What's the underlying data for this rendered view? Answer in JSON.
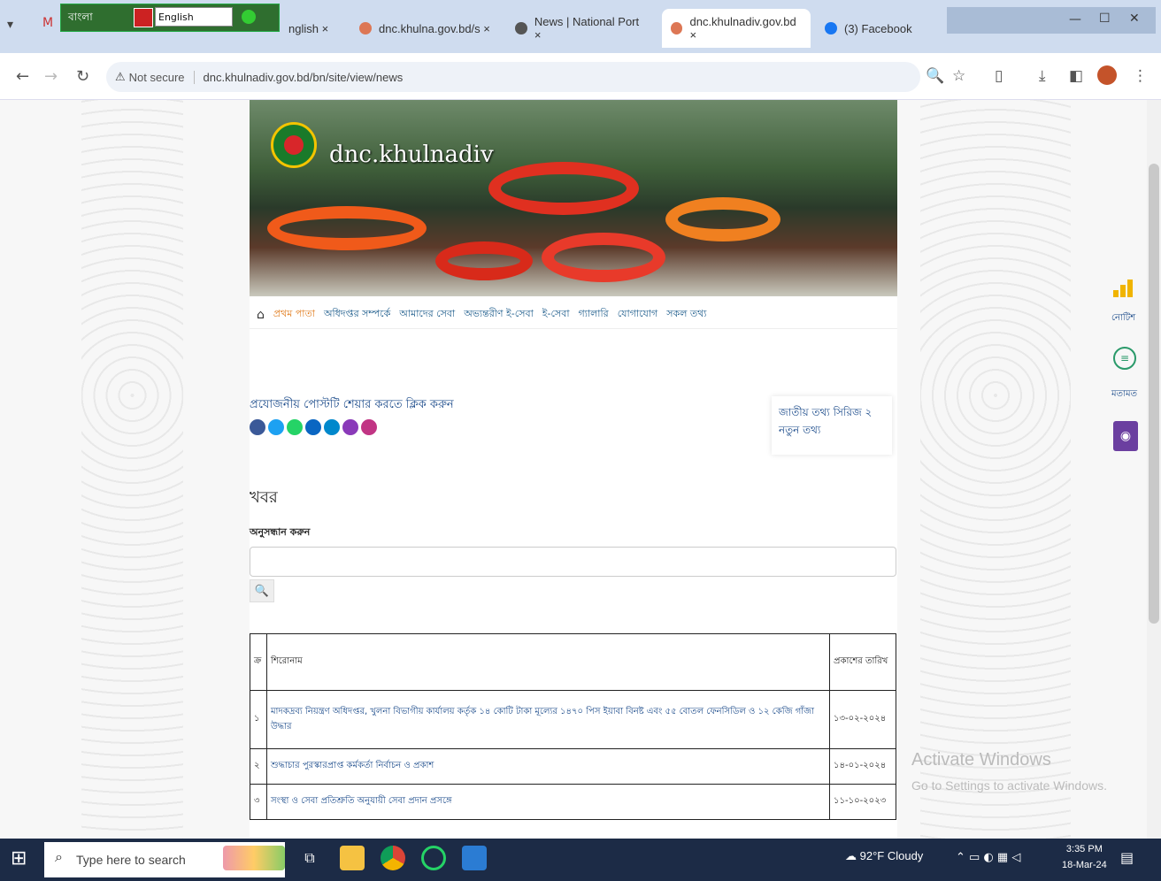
{
  "browser": {
    "tabs": [
      {
        "label": "nglish ×",
        "active": false
      },
      {
        "label": "dnc.khulna.gov.bd/s ×",
        "active": false
      },
      {
        "label": "News | National Port ×",
        "active": false
      },
      {
        "label": "dnc.khulnadiv.gov.bd ×",
        "active": true
      },
      {
        "label": "(3) Facebook",
        "active": false
      }
    ],
    "extension": {
      "lang_left": "বাংলা",
      "lang_right": "English"
    },
    "not_secure": "Not secure",
    "url": "dnc.khulnadiv.gov.bd/bn/site/view/news"
  },
  "site": {
    "name": "dnc.khulnadiv",
    "menu": [
      "প্রথম পাতা",
      "অধিদপ্তর সম্পর্কে",
      "আমাদের সেবা",
      "অভ্যন্তরীণ ই-সেবা",
      "ই-সেবা",
      "গ্যালারি",
      "যোগাযোগ",
      "সকল তথ্য"
    ],
    "social_title": "প্রযোজনীয় পোস্টটি শেয়ার করতে ক্লিক করুন",
    "social_icons": [
      "facebook-icon",
      "twitter-icon",
      "whatsapp-icon",
      "linkedin-icon",
      "messenger-icon",
      "telegram-icon",
      "share-icon"
    ],
    "notice": "জাতীয় তথ্য সিরিজ ২ নতুন তথ্য",
    "page_title": "খবর",
    "search_label": "অনুসন্ধান করুন",
    "search_placeholder": ""
  },
  "news_table": {
    "headers": [
      "ক্র",
      "শিরোনাম",
      "প্রকাশের তারিখ"
    ],
    "rows": [
      {
        "no": "১",
        "title": "মাদকদ্রব্য নিয়ন্ত্রণ অধিদপ্তর, খুলনা বিভাগীয় কার্যালয় কর্তৃক ১৪ কোটি টাকা মূল্যের ১৪৭০ পিস ইয়াবা বিনষ্ট এবং ৫৫ বোতল ফেনসিডিল ও ১২ কেজি গাঁজা উদ্ধার",
        "date": "১৩-০২-২০২৪"
      },
      {
        "no": "২",
        "title": "শুদ্ধাচার পুরস্কারপ্রাপ্ত কর্মকর্তা নির্বাচন ও প্রকাশ",
        "date": "১৪-০১-২০২৪"
      },
      {
        "no": "৩",
        "title": "সংস্থা ও সেবা প্রতিশ্রুতি অনুযায়ী সেবা প্রদান প্রসঙ্গে",
        "date": "১১-১০-২০২৩"
      }
    ]
  },
  "sidebar_right": {
    "label1": "নোটিশ",
    "label2": "মতামত"
  },
  "watermark": {
    "line1": "Activate Windows",
    "line2": "Go to Settings to activate Windows."
  },
  "taskbar": {
    "search_placeholder": "Type here to search",
    "weather": "92°F  Cloudy",
    "time": "3:35 PM",
    "date": "18-Mar-24"
  },
  "colors": {
    "link": "#1a4a8a",
    "menu_active": "#e07a1a",
    "taskbar": "#1c2b46"
  }
}
